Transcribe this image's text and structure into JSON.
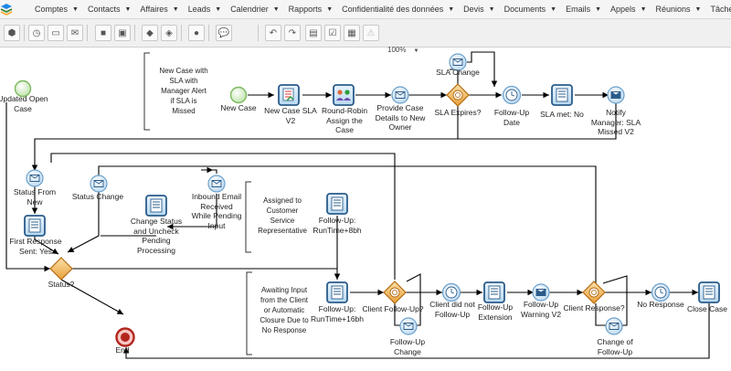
{
  "nav": {
    "items": [
      "Comptes",
      "Contacts",
      "Affaires",
      "Leads",
      "Calendrier",
      "Rapports",
      "Confidentialité des données",
      "Devis",
      "Documents",
      "Emails",
      "Appels",
      "Réunions",
      "Tâches"
    ]
  },
  "toolbar": {
    "zoom": "100%"
  },
  "diagram": {
    "labels": {
      "updated_open_case": "Updated Open\nCase",
      "new_case": "New Case",
      "new_case_sla_v2": "New Case SLA\nV2",
      "round_robin": "Round-Robin\nAssign the\nCase",
      "provide_case_details": "Provide Case\nDetails to New\nOwner",
      "sla_change": "SLA Change",
      "sla_expires": "SLA Expires?",
      "follow_up_date": "Follow-Up\nDate",
      "sla_met_no": "SLA met: No",
      "notify_manager": "Notify\nManager: SLA\nMissed V2",
      "status_from_new": "Status From\nNew",
      "status_change": "Status Change",
      "inbound_email": "Inbound Email\nReceived\nWhile Pending\nInput",
      "change_status_uncheck": "Change Status\nand Uncheck\nPending\nProcessing",
      "first_response_sent": "First Response\nSent: Yes",
      "follow_up_8bh": "Follow-Up:\nRunTime+8bh",
      "status_q": "Status?",
      "end": "End",
      "follow_up_16bh": "Follow-Up:\nRunTime+16bh",
      "client_follow_up_q": "Client Follow-Up?",
      "follow_up_change": "Follow-Up\nChange",
      "client_did_not_follow_up": "Client did not\nFollow-Up",
      "follow_up_extension": "Follow-Up\nExtension",
      "follow_up_warning_v2": "Follow-Up\nWarning V2",
      "client_response_q": "Client Response?",
      "change_of_follow_up": "Change of\nFollow-Up",
      "no_response": "No Response",
      "close_case": "Close Case"
    },
    "notes": {
      "note_sla": "New Case with\nSLA with\nManager Alert\nif SLA is\nMissed",
      "note_assigned": "Assigned to\nCustomer\nService\nRepresentative",
      "note_awaiting": "Awaiting Input\nfrom the Client\nor Automatic\nClosure Due to\nNo Response"
    }
  }
}
